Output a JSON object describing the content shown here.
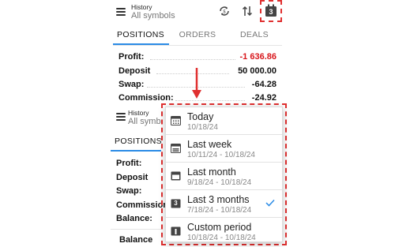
{
  "top": {
    "title": "History",
    "subtitle": "All symbols",
    "calendar_badge": "3",
    "tabs": [
      "POSITIONS",
      "ORDERS",
      "DEALS"
    ],
    "rows": [
      {
        "label": "Profit:",
        "value": "-1 636.86",
        "negative": true
      },
      {
        "label": "Deposit",
        "value": "50 000.00"
      },
      {
        "label": "Swap:",
        "value": "-64.28"
      },
      {
        "label": "Commission:",
        "value": "-24.92"
      }
    ]
  },
  "bottom": {
    "title": "History",
    "subtitle": "All symbols",
    "tab": "POSITIONS",
    "rows": [
      "Profit:",
      "Deposit",
      "Swap:",
      "Commission:",
      "Balance:"
    ],
    "footer_label": "Balance"
  },
  "menu": {
    "items": [
      {
        "label": "Today",
        "date": "10/18/24",
        "icon": "calendar-day-icon"
      },
      {
        "label": "Last week",
        "date": "10/11/24 - 10/18/24",
        "icon": "calendar-week-icon"
      },
      {
        "label": "Last month",
        "date": "9/18/24 - 10/18/24",
        "icon": "calendar-month-icon"
      },
      {
        "label": "Last 3 months",
        "date": "7/18/24 - 10/18/24",
        "icon": "calendar-3-icon",
        "badge": "3",
        "selected": true
      },
      {
        "label": "Custom period",
        "date": "10/18/24 - 10/18/24",
        "icon": "calendar-custom-icon"
      }
    ]
  },
  "colors": {
    "accent": "#2b8be6",
    "negative": "#d8171c",
    "highlight": "#e03030"
  }
}
